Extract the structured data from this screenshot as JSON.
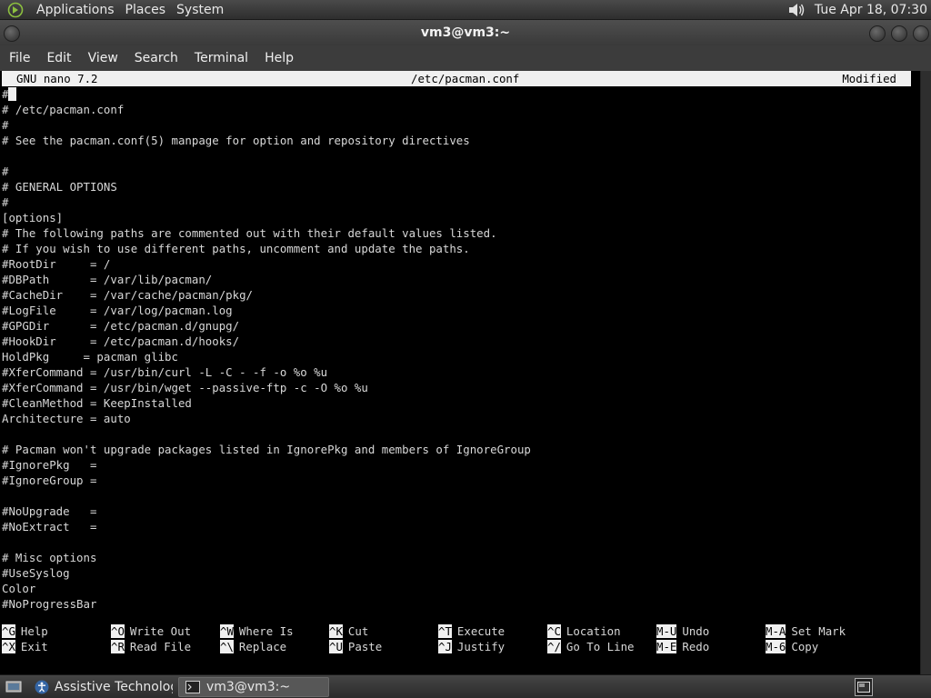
{
  "top_panel": {
    "menus": [
      "Applications",
      "Places",
      "System"
    ],
    "clock": "Tue Apr 18, 07:30",
    "icons": {
      "logo": "gnome-foot-icon",
      "volume": "volume-icon"
    }
  },
  "window": {
    "title": "vm3@vm3:~",
    "menu": [
      "File",
      "Edit",
      "View",
      "Search",
      "Terminal",
      "Help"
    ]
  },
  "nano": {
    "version": "GNU nano 7.2",
    "filename": "/etc/pacman.conf",
    "status": "Modified",
    "first_line": "#",
    "lines": [
      "# /etc/pacman.conf",
      "#",
      "# See the pacman.conf(5) manpage for option and repository directives",
      "",
      "#",
      "# GENERAL OPTIONS",
      "#",
      "[options]",
      "# The following paths are commented out with their default values listed.",
      "# If you wish to use different paths, uncomment and update the paths.",
      "#RootDir     = /",
      "#DBPath      = /var/lib/pacman/",
      "#CacheDir    = /var/cache/pacman/pkg/",
      "#LogFile     = /var/log/pacman.log",
      "#GPGDir      = /etc/pacman.d/gnupg/",
      "#HookDir     = /etc/pacman.d/hooks/",
      "HoldPkg     = pacman glibc",
      "#XferCommand = /usr/bin/curl -L -C - -f -o %o %u",
      "#XferCommand = /usr/bin/wget --passive-ftp -c -O %o %u",
      "#CleanMethod = KeepInstalled",
      "Architecture = auto",
      "",
      "# Pacman won't upgrade packages listed in IgnorePkg and members of IgnoreGroup",
      "#IgnorePkg   =",
      "#IgnoreGroup =",
      "",
      "#NoUpgrade   =",
      "#NoExtract   =",
      "",
      "# Misc options",
      "#UseSyslog",
      "Color",
      "#NoProgressBar"
    ],
    "shortcuts_row1": [
      {
        "key": "^G",
        "label": "Help"
      },
      {
        "key": "^O",
        "label": "Write Out"
      },
      {
        "key": "^W",
        "label": "Where Is"
      },
      {
        "key": "^K",
        "label": "Cut"
      },
      {
        "key": "^T",
        "label": "Execute"
      },
      {
        "key": "^C",
        "label": "Location"
      },
      {
        "key": "M-U",
        "label": "Undo"
      },
      {
        "key": "M-A",
        "label": "Set Mark"
      }
    ],
    "shortcuts_row2": [
      {
        "key": "^X",
        "label": "Exit"
      },
      {
        "key": "^R",
        "label": "Read File"
      },
      {
        "key": "^\\",
        "label": "Replace"
      },
      {
        "key": "^U",
        "label": "Paste"
      },
      {
        "key": "^J",
        "label": "Justify"
      },
      {
        "key": "^/",
        "label": "Go To Line"
      },
      {
        "key": "M-E",
        "label": "Redo"
      },
      {
        "key": "M-6",
        "label": "Copy"
      }
    ]
  },
  "bottom_panel": {
    "tasks": [
      {
        "label": "Assistive Technologi...",
        "icon": "accessibility-icon"
      },
      {
        "label": "vm3@vm3:~",
        "icon": "terminal-icon"
      }
    ]
  }
}
